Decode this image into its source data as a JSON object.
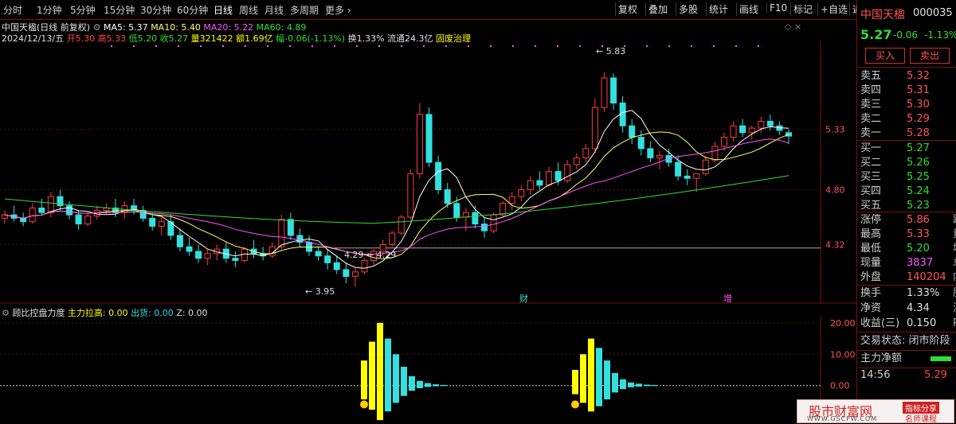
{
  "toolbar": {
    "periods": [
      "分时",
      "1分钟",
      "5分钟",
      "15分钟",
      "30分钟",
      "60分钟",
      "日线",
      "周线",
      "月线",
      "多周期",
      "更多 ›"
    ],
    "active_period": "日线",
    "tools": [
      "复权",
      "叠加",
      "多股",
      "统计",
      "画线",
      "F10",
      "标记",
      "+自选",
      "返回"
    ]
  },
  "info": {
    "title": "中国天楹(日线 前复权)",
    "ma5": "MA5: 5.37",
    "ma10": "MA10: 5.40",
    "ma20": "MA20: 5.22",
    "ma60": "MA60: 4.89",
    "date": "2024/12/13/五",
    "open": "开5.30",
    "high": "高5.33",
    "low": "低5.20",
    "close": "收5.27",
    "volume": "量321422",
    "amount": "额1.69亿",
    "change": "幅-0.06(-1.13%)",
    "turnover": "换1.33%",
    "float": "流通24.3亿",
    "concept": "固废治理"
  },
  "price_axis": [
    "5.33",
    "4.80",
    "4.32"
  ],
  "annotations": {
    "high": "5.83",
    "low": "3.95",
    "mid": "4.29",
    "mid_left": "4.29",
    "cai": "财",
    "zeng": "增"
  },
  "sub": {
    "name": "顾比控盘力度",
    "lagao": "主力拉高: 0.00",
    "chuhuo": "出货: 0.00",
    "z": "Z: 0.00",
    "axis": [
      "20.00",
      "10.00",
      "0.00"
    ]
  },
  "chart_data": {
    "type": "candlestick",
    "title": "中国天楹(日线 前复权)",
    "ylim": [
      3.8,
      6.1
    ],
    "candles": [
      [
        4.55,
        4.62,
        4.5,
        4.58
      ],
      [
        4.58,
        4.66,
        4.52,
        4.55
      ],
      [
        4.55,
        4.6,
        4.48,
        4.52
      ],
      [
        4.52,
        4.68,
        4.5,
        4.64
      ],
      [
        4.64,
        4.72,
        4.58,
        4.6
      ],
      [
        4.6,
        4.78,
        4.56,
        4.74
      ],
      [
        4.74,
        4.8,
        4.62,
        4.66
      ],
      [
        4.66,
        4.7,
        4.54,
        4.58
      ],
      [
        4.58,
        4.62,
        4.45,
        4.5
      ],
      [
        4.5,
        4.6,
        4.48,
        4.57
      ],
      [
        4.57,
        4.66,
        4.54,
        4.62
      ],
      [
        4.62,
        4.68,
        4.58,
        4.64
      ],
      [
        4.64,
        4.72,
        4.56,
        4.6
      ],
      [
        4.6,
        4.7,
        4.55,
        4.66
      ],
      [
        4.66,
        4.72,
        4.58,
        4.62
      ],
      [
        4.62,
        4.66,
        4.52,
        4.55
      ],
      [
        4.55,
        4.6,
        4.44,
        4.48
      ],
      [
        4.48,
        4.56,
        4.4,
        4.52
      ],
      [
        4.52,
        4.58,
        4.36,
        4.4
      ],
      [
        4.4,
        4.46,
        4.26,
        4.3
      ],
      [
        4.3,
        4.38,
        4.22,
        4.26
      ],
      [
        4.26,
        4.32,
        4.16,
        4.2
      ],
      [
        4.2,
        4.28,
        4.14,
        4.24
      ],
      [
        4.24,
        4.32,
        4.18,
        4.28
      ],
      [
        4.28,
        4.34,
        4.16,
        4.2
      ],
      [
        4.2,
        4.26,
        4.12,
        4.18
      ],
      [
        4.18,
        4.3,
        4.16,
        4.28
      ],
      [
        4.28,
        4.36,
        4.2,
        4.24
      ],
      [
        4.24,
        4.3,
        4.18,
        4.22
      ],
      [
        4.22,
        4.34,
        4.2,
        4.3
      ],
      [
        4.3,
        4.58,
        4.28,
        4.54
      ],
      [
        4.54,
        4.6,
        4.36,
        4.4
      ],
      [
        4.4,
        4.46,
        4.3,
        4.34
      ],
      [
        4.34,
        4.4,
        4.22,
        4.26
      ],
      [
        4.26,
        4.3,
        4.18,
        4.22
      ],
      [
        4.22,
        4.28,
        4.1,
        4.16
      ],
      [
        4.16,
        4.22,
        4.06,
        4.1
      ],
      [
        4.1,
        4.16,
        3.98,
        4.04
      ],
      [
        4.04,
        4.12,
        3.95,
        4.08
      ],
      [
        4.08,
        4.2,
        4.06,
        4.18
      ],
      [
        4.18,
        4.28,
        4.14,
        4.26
      ],
      [
        4.26,
        4.36,
        4.22,
        4.32
      ],
      [
        4.32,
        4.44,
        4.3,
        4.42
      ],
      [
        4.42,
        4.58,
        4.4,
        4.56
      ],
      [
        4.56,
        4.98,
        4.54,
        4.94
      ],
      [
        4.94,
        5.56,
        4.9,
        5.46
      ],
      [
        5.46,
        5.52,
        5.0,
        5.04
      ],
      [
        5.04,
        5.1,
        4.76,
        4.8
      ],
      [
        4.8,
        4.86,
        4.64,
        4.68
      ],
      [
        4.68,
        4.74,
        4.52,
        4.56
      ],
      [
        4.56,
        4.64,
        4.44,
        4.6
      ],
      [
        4.6,
        4.66,
        4.46,
        4.5
      ],
      [
        4.5,
        4.56,
        4.38,
        4.44
      ],
      [
        4.44,
        4.6,
        4.42,
        4.58
      ],
      [
        4.58,
        4.7,
        4.56,
        4.68
      ],
      [
        4.68,
        4.78,
        4.62,
        4.74
      ],
      [
        4.74,
        4.84,
        4.7,
        4.8
      ],
      [
        4.8,
        4.92,
        4.76,
        4.88
      ],
      [
        4.88,
        4.96,
        4.8,
        4.84
      ],
      [
        4.84,
        5.0,
        4.82,
        4.96
      ],
      [
        4.96,
        5.04,
        4.84,
        4.88
      ],
      [
        4.88,
        5.06,
        4.86,
        5.02
      ],
      [
        5.02,
        5.12,
        4.98,
        5.08
      ],
      [
        5.08,
        5.2,
        5.04,
        5.16
      ],
      [
        5.16,
        5.6,
        5.12,
        5.52
      ],
      [
        5.52,
        5.83,
        5.48,
        5.78
      ],
      [
        5.78,
        5.82,
        5.5,
        5.56
      ],
      [
        5.56,
        5.62,
        5.3,
        5.36
      ],
      [
        5.36,
        5.42,
        5.2,
        5.26
      ],
      [
        5.26,
        5.32,
        5.1,
        5.16
      ],
      [
        5.16,
        5.22,
        5.04,
        5.08
      ],
      [
        5.08,
        5.14,
        4.98,
        5.1
      ],
      [
        5.1,
        5.16,
        5.0,
        5.04
      ],
      [
        5.04,
        5.1,
        4.88,
        4.92
      ],
      [
        4.92,
        4.98,
        4.84,
        4.9
      ],
      [
        4.9,
        4.94,
        4.78,
        4.94
      ],
      [
        4.94,
        5.1,
        4.92,
        5.06
      ],
      [
        5.06,
        5.22,
        5.04,
        5.18
      ],
      [
        5.18,
        5.3,
        5.14,
        5.26
      ],
      [
        5.26,
        5.4,
        5.22,
        5.36
      ],
      [
        5.36,
        5.42,
        5.26,
        5.3
      ],
      [
        5.3,
        5.36,
        5.24,
        5.34
      ],
      [
        5.34,
        5.44,
        5.3,
        5.4
      ],
      [
        5.4,
        5.46,
        5.32,
        5.36
      ],
      [
        5.36,
        5.4,
        5.28,
        5.32
      ],
      [
        5.3,
        5.33,
        5.2,
        5.27
      ]
    ],
    "ma": [
      {
        "name": "MA5",
        "color": "#ffffff"
      },
      {
        "name": "MA10",
        "color": "#ffff66"
      },
      {
        "name": "MA20",
        "color": "#ff55ff"
      },
      {
        "name": "MA60",
        "color": "#33dd33"
      }
    ]
  },
  "sub_chart_data": {
    "type": "bar",
    "ylim": [
      -12,
      22
    ],
    "groups": [
      {
        "start": 453,
        "yellow": [
          8,
          14,
          20
        ],
        "cyan": [
          15,
          10,
          6,
          3,
          1.5,
          0.8,
          0.4,
          0.2
        ]
      },
      {
        "start": 718,
        "yellow": [
          5,
          10,
          15
        ],
        "cyan": [
          12,
          8,
          4,
          2,
          1,
          0.6,
          0.3,
          0.2
        ]
      }
    ]
  },
  "stock": {
    "name": "中国天楹",
    "code": "000035",
    "price": "5.27",
    "change": "-0.06",
    "pct": "-1.13%",
    "buy": "买入",
    "sell": "卖出"
  },
  "orderbook": {
    "sells": [
      [
        "卖五",
        "5.32"
      ],
      [
        "卖四",
        "5.31"
      ],
      [
        "卖三",
        "5.30"
      ],
      [
        "卖二",
        "5.29"
      ],
      [
        "卖一",
        "5.28"
      ]
    ],
    "buys": [
      [
        "买一",
        "5.27"
      ],
      [
        "买二",
        "5.26"
      ],
      [
        "买三",
        "5.25"
      ],
      [
        "买四",
        "5.24"
      ],
      [
        "买五",
        "5.23"
      ]
    ]
  },
  "stats": [
    {
      "label": "涨停",
      "value": "5.86",
      "tail": "跌"
    },
    {
      "label": "最高",
      "value": "5.33",
      "tail": "量"
    },
    {
      "label": "最低",
      "value": "5.20",
      "tail": "均"
    },
    {
      "label": "现量",
      "value": "3837",
      "tail": "总"
    },
    {
      "label": "外盘",
      "value": "140204",
      "tail": "内"
    }
  ],
  "stats2": [
    {
      "label": "换手",
      "value": "1.33%",
      "tail": "股"
    },
    {
      "label": "净资",
      "value": "4.34",
      "tail": "流"
    },
    {
      "label": "收益(三)",
      "value": "0.150",
      "tail": "P"
    }
  ],
  "trade_status": "交易状态: 闭市阶段",
  "net_amount": "主力净额",
  "tick": {
    "time": "14:56",
    "price": "5.29"
  },
  "watermark": {
    "text": "股市财富网",
    "url": "WWW.GSCFW.COM",
    "tag1": "指标分享",
    "tag2": "名师课程"
  }
}
